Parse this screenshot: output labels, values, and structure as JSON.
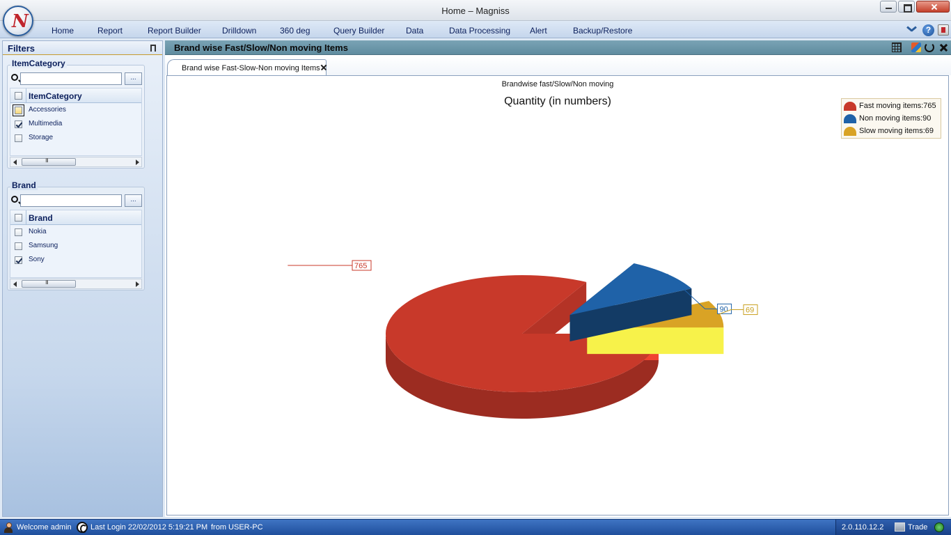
{
  "window": {
    "title": "Home – Magniss",
    "logo_letter": "N"
  },
  "menu": {
    "items": [
      "Home",
      "Report",
      "Report Builder",
      "Drilldown",
      "360 deg",
      "Query Builder",
      "Data",
      "Data Processing",
      "Alert",
      "Backup/Restore"
    ],
    "help_label": "?"
  },
  "sidebar": {
    "title": "Filters",
    "groups": [
      {
        "label": "ItemCategory",
        "search_value": "",
        "browse_label": "...",
        "column_header": "ItemCategory",
        "rows": [
          {
            "label": "Accessories",
            "checked": false,
            "focused": true
          },
          {
            "label": "Multimedia",
            "checked": true,
            "focused": false
          },
          {
            "label": "Storage",
            "checked": false,
            "focused": false
          }
        ]
      },
      {
        "label": "Brand",
        "search_value": "",
        "browse_label": "...",
        "column_header": "Brand",
        "rows": [
          {
            "label": "Nokia",
            "checked": false,
            "focused": false
          },
          {
            "label": "Samsung",
            "checked": false,
            "focused": false
          },
          {
            "label": "Sony",
            "checked": true,
            "focused": false
          }
        ]
      }
    ]
  },
  "main": {
    "title": "Brand wise Fast/Slow/Non moving Items",
    "tab_label": "Brand wise Fast-Slow-Non moving Items"
  },
  "chart_data": {
    "type": "pie",
    "title": "Quantity (in numbers)",
    "subtitle": "Brandwise fast/Slow/Non moving",
    "three_d": true,
    "legend_position": "top-right",
    "series": [
      {
        "name": "Fast moving items",
        "value": 765,
        "color": "#c8392a",
        "label": "Fast moving items:765"
      },
      {
        "name": "Non moving items",
        "value": 90,
        "color": "#1f62a8",
        "label": "Non moving items:90"
      },
      {
        "name": "Slow moving items",
        "value": 69,
        "color": "#d9a325",
        "label": "Slow moving items:69"
      }
    ],
    "data_labels": [
      "765",
      "90",
      "69"
    ]
  },
  "statusbar": {
    "welcome": "Welcome admin",
    "last_login": "Last Login 22/02/2012 5:19:21 PM",
    "from": "from USER-PC",
    "version": "2.0.110.12.2",
    "trade": "Trade"
  }
}
